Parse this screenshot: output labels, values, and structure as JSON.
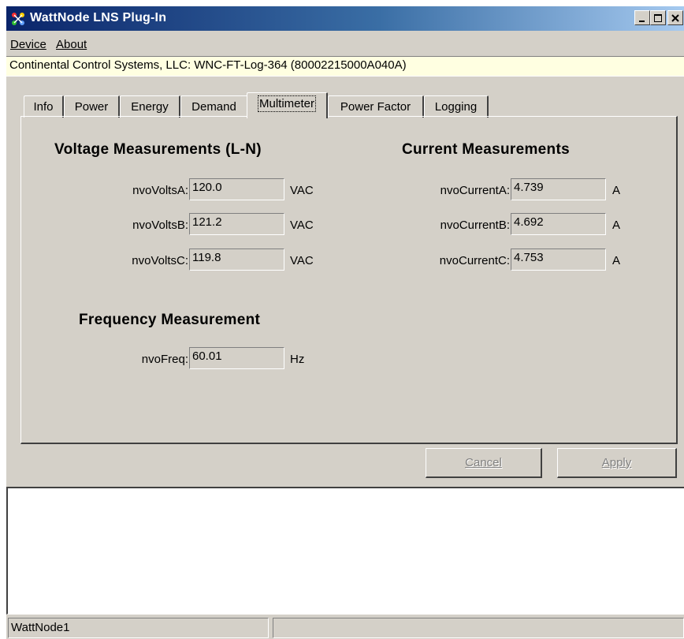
{
  "window": {
    "title": "WattNode LNS Plug-In",
    "controls": [
      "minimize",
      "maximize",
      "close"
    ]
  },
  "menu": {
    "device": "Device",
    "about": "About"
  },
  "device_line": "Continental Control Systems, LLC: WNC-FT-Log-364 (80002215000A040A)",
  "tabs": [
    "Info",
    "Power",
    "Energy",
    "Demand",
    "Multimeter",
    "Power Factor",
    "Logging"
  ],
  "active_tab": "Multimeter",
  "voltage": {
    "title": "Voltage Measurements (L-N)",
    "rows": [
      {
        "label": "nvoVoltsA:",
        "value": "120.0",
        "unit": "VAC"
      },
      {
        "label": "nvoVoltsB:",
        "value": "121.2",
        "unit": "VAC"
      },
      {
        "label": "nvoVoltsC:",
        "value": "119.8",
        "unit": "VAC"
      }
    ]
  },
  "current": {
    "title": "Current Measurements",
    "rows": [
      {
        "label": "nvoCurrentA:",
        "value": "4.739",
        "unit": "A"
      },
      {
        "label": "nvoCurrentB:",
        "value": "4.692",
        "unit": "A"
      },
      {
        "label": "nvoCurrentC:",
        "value": "4.753",
        "unit": "A"
      }
    ]
  },
  "frequency": {
    "title": "Frequency Measurement",
    "label": "nvoFreq:",
    "value": "60.01",
    "unit": "Hz"
  },
  "buttons": {
    "cancel": "Cancel",
    "apply": "Apply"
  },
  "status": {
    "pane1": "WattNode1",
    "pane2": ""
  },
  "colors": {
    "title_gradient_start": "#0a246a",
    "title_gradient_end": "#a6caf0",
    "face": "#d4d0c8",
    "device_line_bg": "#ffffe1"
  },
  "icons": [
    "app-network-icon",
    "minimize-icon",
    "maximize-icon",
    "close-icon"
  ]
}
